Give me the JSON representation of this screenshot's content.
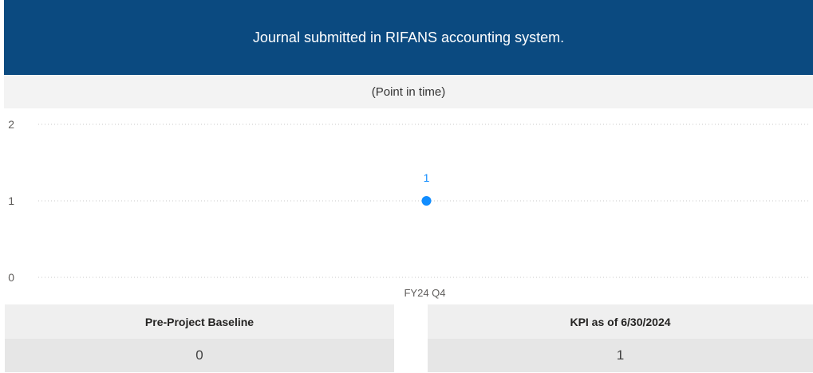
{
  "header": {
    "title": "Journal submitted in RIFANS accounting system."
  },
  "subtitle": "(Point in time)",
  "chart_data": {
    "type": "scatter",
    "categories": [
      "FY24 Q4"
    ],
    "series": [
      {
        "values": [
          1
        ]
      }
    ],
    "data_labels": [
      "1"
    ],
    "yticks": [
      "0",
      "1",
      "2"
    ],
    "ylim": [
      0,
      2
    ],
    "grid": true,
    "point_color": "#118dff"
  },
  "cards": {
    "baseline": {
      "label": "Pre-Project Baseline",
      "value": "0"
    },
    "kpi": {
      "label": "KPI as of 6/30/2024",
      "value": "1"
    }
  }
}
